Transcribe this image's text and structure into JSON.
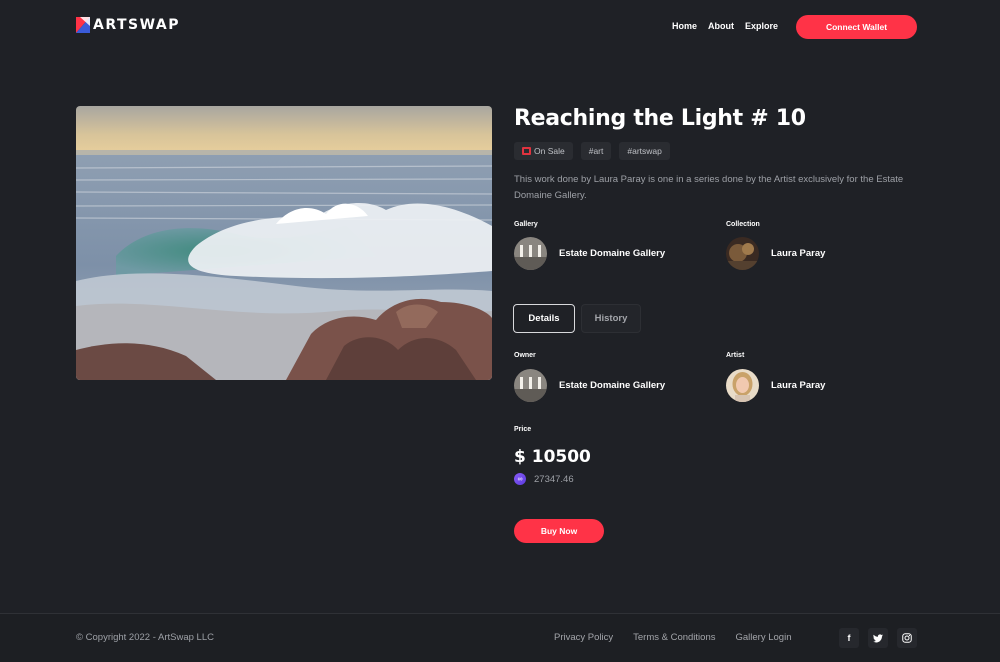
{
  "brand": {
    "name": "ARTSWAP",
    "accent_color": "#ff3347"
  },
  "nav": {
    "items": [
      {
        "label": "Home"
      },
      {
        "label": "About"
      },
      {
        "label": "Explore"
      }
    ],
    "connect_label": "Connect Wallet"
  },
  "artwork": {
    "title": "Reaching the Light # 10",
    "image_subject": "seascape painting of crashing waves on rocks"
  },
  "tags": [
    {
      "label": "On Sale",
      "icon": "image-icon"
    },
    {
      "label": "#art"
    },
    {
      "label": "#artswap"
    }
  ],
  "description": "This work done by Laura Paray is one in a series done by the Artist exclusively for the Estate Domaine Gallery.",
  "gallery": {
    "label": "Gallery",
    "name": "Estate Domaine Gallery"
  },
  "collection": {
    "label": "Collection",
    "name": "Laura Paray"
  },
  "tabs": [
    {
      "label": "Details",
      "active": true
    },
    {
      "label": "History",
      "active": false
    }
  ],
  "owner": {
    "label": "Owner",
    "name": "Estate Domaine Gallery"
  },
  "artist": {
    "label": "Artist",
    "name": "Laura Paray"
  },
  "price": {
    "label": "Price",
    "value": "$ 10500",
    "crypto_value": "27347.46",
    "crypto_icon": "polygon-icon"
  },
  "buy_label": "Buy Now",
  "footer": {
    "copyright": "© Copyright 2022 - ArtSwap LLC",
    "links": [
      {
        "label": "Privacy Policy"
      },
      {
        "label": "Terms & Conditions"
      },
      {
        "label": "Gallery Login"
      }
    ],
    "socials": [
      {
        "icon": "facebook-icon",
        "glyph": "f"
      },
      {
        "icon": "twitter-icon",
        "glyph": "t"
      },
      {
        "icon": "instagram-icon",
        "glyph": "◎"
      }
    ]
  }
}
